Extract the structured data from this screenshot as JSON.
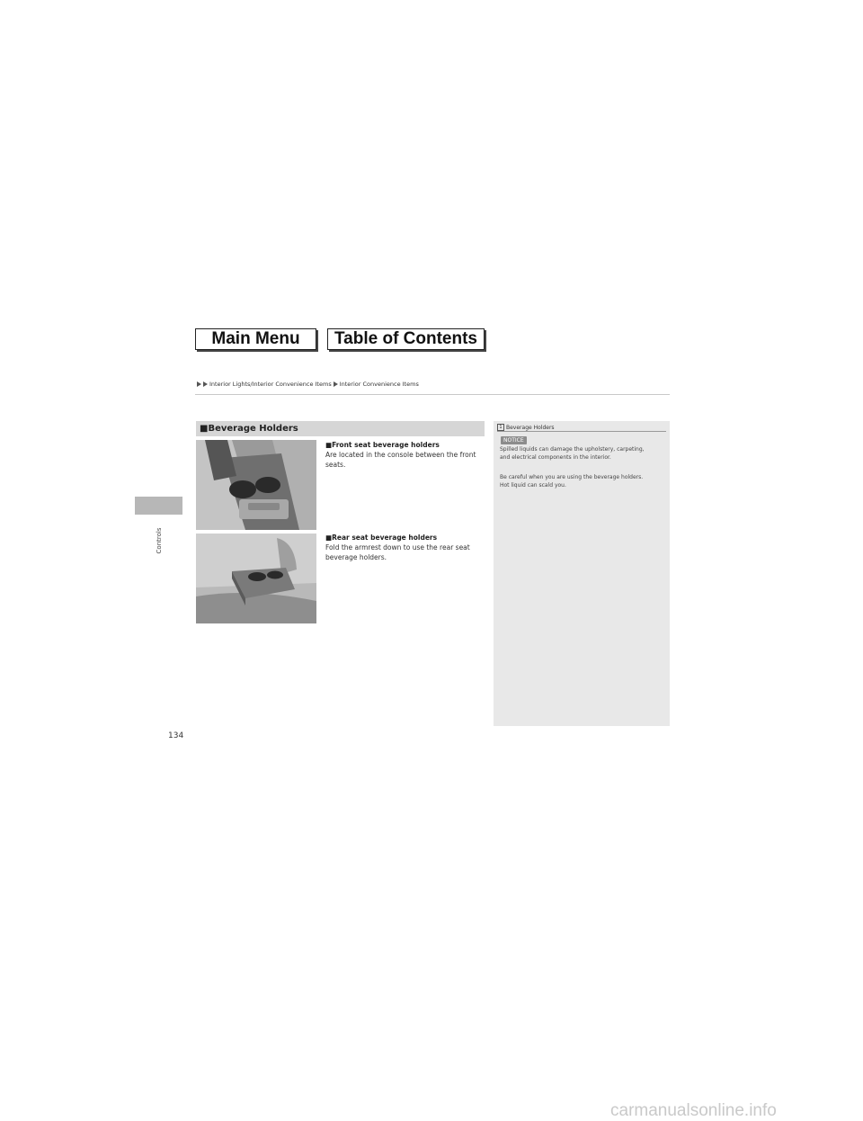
{
  "nav": {
    "main_menu": "Main Menu",
    "table_of_contents": "Table of Contents"
  },
  "breadcrumb": {
    "part1": "Interior Lights/Interior Convenience Items",
    "part2": "Interior Convenience Items"
  },
  "side_tab": {
    "label": "Controls"
  },
  "section": {
    "title": "■Beverage Holders",
    "front": {
      "heading": "■Front seat beverage holders",
      "text_line1": "Are located in the console between the front",
      "text_line2": "seats."
    },
    "rear": {
      "heading": "■Rear seat beverage holders",
      "text_line1": "Fold the armrest down to use the rear seat",
      "text_line2": "beverage holders."
    }
  },
  "side_panel": {
    "title_icon": "1",
    "title": "Beverage Holders",
    "notice_label": "NOTICE",
    "notice_line1": "Spilled liquids can damage the upholstery, carpeting,",
    "notice_line2": "and electrical components in the interior.",
    "caution_line1": "Be careful when you are using the beverage holders.",
    "caution_line2": "Hot liquid can scald you."
  },
  "page_number": "134",
  "footer": "carmanualsonline.info"
}
